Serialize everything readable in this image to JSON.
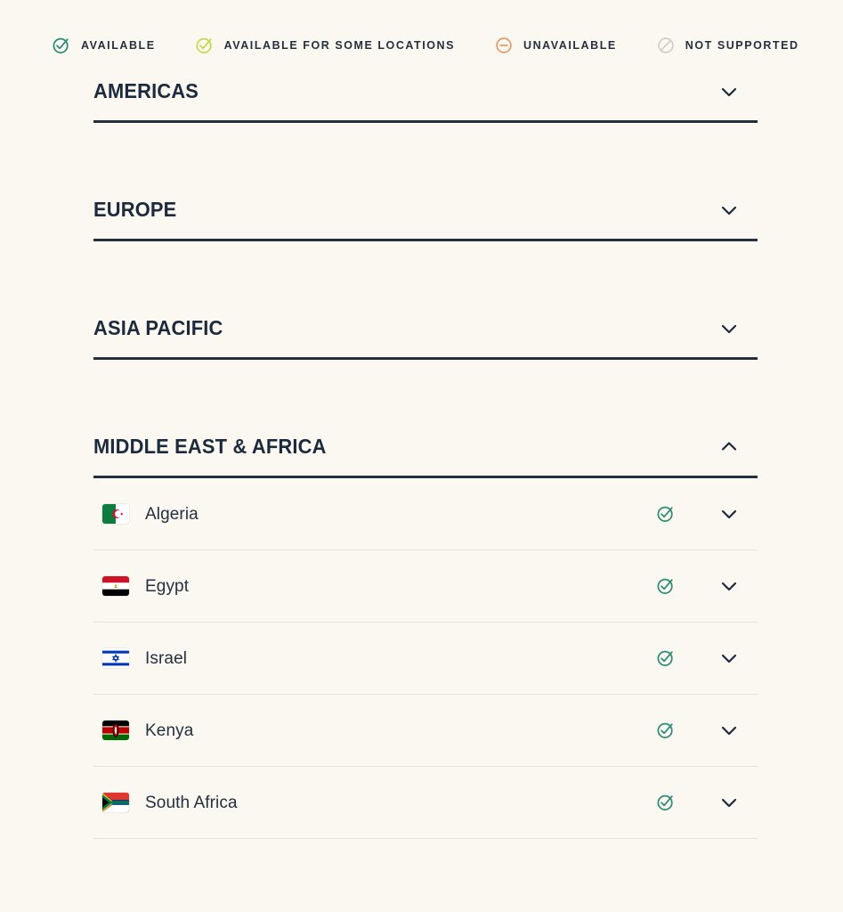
{
  "legend": {
    "items": [
      {
        "icon": "check-circle-icon",
        "label": "AVAILABLE",
        "color": "#2e8b76"
      },
      {
        "icon": "check-circle-icon",
        "label": "AVAILABLE FOR SOME LOCATIONS",
        "color": "#c8d84a"
      },
      {
        "icon": "minus-circle-icon",
        "label": "UNAVAILABLE",
        "color": "#e29a62"
      },
      {
        "icon": "no-entry-icon",
        "label": "NOT SUPPORTED",
        "color": "#cfcdc6"
      }
    ]
  },
  "regions": [
    {
      "title": "AMERICAS",
      "expanded": false,
      "chevron": "chevron-down-icon",
      "countries": []
    },
    {
      "title": "EUROPE",
      "expanded": false,
      "chevron": "chevron-down-icon",
      "countries": []
    },
    {
      "title": "ASIA PACIFIC",
      "expanded": false,
      "chevron": "chevron-down-icon",
      "countries": []
    },
    {
      "title": "MIDDLE EAST & AFRICA",
      "expanded": true,
      "chevron": "chevron-up-icon",
      "countries": [
        {
          "name": "Algeria",
          "flag": "flag-algeria",
          "status": "AVAILABLE",
          "status_icon": "check-circle-icon",
          "status_color": "#2e8b76",
          "chevron": "chevron-down-icon"
        },
        {
          "name": "Egypt",
          "flag": "flag-egypt",
          "status": "AVAILABLE",
          "status_icon": "check-circle-icon",
          "status_color": "#2e8b76",
          "chevron": "chevron-down-icon"
        },
        {
          "name": "Israel",
          "flag": "flag-israel",
          "status": "AVAILABLE",
          "status_icon": "check-circle-icon",
          "status_color": "#2e8b76",
          "chevron": "chevron-down-icon"
        },
        {
          "name": "Kenya",
          "flag": "flag-kenya",
          "status": "AVAILABLE",
          "status_icon": "check-circle-icon",
          "status_color": "#2e8b76",
          "chevron": "chevron-down-icon"
        },
        {
          "name": "South Africa",
          "flag": "flag-south-africa",
          "status": "AVAILABLE",
          "status_icon": "check-circle-icon",
          "status_color": "#2e8b76",
          "chevron": "chevron-down-icon"
        }
      ]
    }
  ],
  "colors": {
    "background": "#faf8f1",
    "text": "#24303f",
    "heading": "#1b2a3d",
    "rule": "#24303f",
    "divider": "#e6e3db"
  }
}
